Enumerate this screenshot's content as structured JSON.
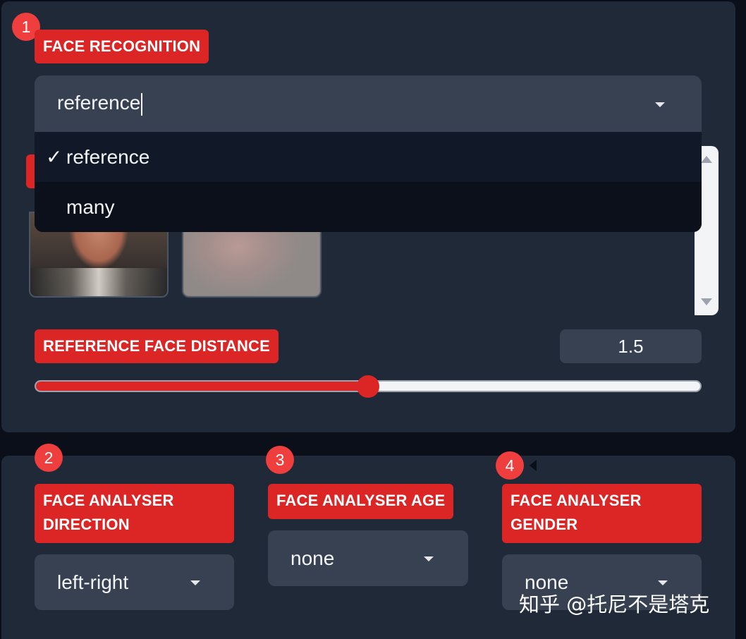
{
  "face_recognition": {
    "badge": "1",
    "label": "FACE RECOGNITION",
    "selected": "reference",
    "options": [
      {
        "check": "✓",
        "label": "reference"
      },
      {
        "check": "",
        "label": "many"
      }
    ]
  },
  "reference_face_distance": {
    "label": "REFERENCE FACE DISTANCE",
    "value": "1.5",
    "slider_fraction": 0.5
  },
  "face_analyser_direction": {
    "badge": "2",
    "label_line1": "FACE ANALYSER",
    "label_line2": "DIRECTION",
    "selected": "left-right"
  },
  "face_analyser_age": {
    "badge": "3",
    "label": "FACE ANALYSER AGE",
    "selected": "none"
  },
  "face_analyser_gender": {
    "badge": "4",
    "label_line1": "FACE ANALYSER",
    "label_line2": "GENDER",
    "selected": "none"
  },
  "colors": {
    "accent": "#dc2626",
    "panel": "#1f2937",
    "input": "#374151",
    "background": "#0b0f19"
  },
  "watermark": "知乎 @托尼不是塔克"
}
